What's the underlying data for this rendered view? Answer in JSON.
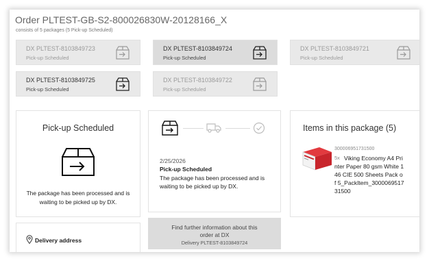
{
  "order": {
    "title": "Order PLTEST-GB-S2-800026830W-20128166_X",
    "subtitle": "consists of 5 packages (5 Pick-up Scheduled)"
  },
  "packages": [
    {
      "id": "DX PLTEST-8103849723",
      "status": "Pick-up Scheduled"
    },
    {
      "id": "DX PLTEST-8103849724",
      "status": "Pick-up Scheduled"
    },
    {
      "id": "DX PLTEST-8103849721",
      "status": "Pick-up Scheduled"
    },
    {
      "id": "DX PLTEST-8103849725",
      "status": "Pick-up Scheduled"
    },
    {
      "id": "DX PLTEST-8103849722",
      "status": "Pick-up Scheduled"
    }
  ],
  "status_card": {
    "heading": "Pick-up Scheduled",
    "description": "The package has been processed and is waiting to be picked up by DX."
  },
  "tracking": {
    "date": "2/25/2026",
    "status": "Pick-up Scheduled",
    "description": "The package has been processed and is waiting to be picked up by DX."
  },
  "items": {
    "heading": "Items in this package (5)",
    "list": [
      {
        "code": "300006951731500",
        "qty": "5x",
        "name": "Viking Economy A4 Printer Paper 80 gsm White 146 CIE 500 Sheets Pack of 5_PackItem_300006951731500"
      }
    ]
  },
  "address": {
    "label": "Delivery address"
  },
  "info": {
    "line1": "Find further information about this order at DX",
    "sub": "Delivery PLTEST-8103849724"
  },
  "colors": {
    "selected_tile": "#dcdcdc",
    "tile": "#e9e9e9",
    "product_red": "#c8252c"
  }
}
